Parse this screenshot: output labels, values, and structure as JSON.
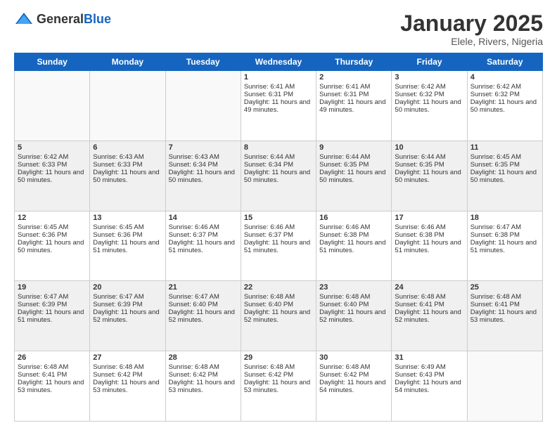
{
  "header": {
    "logo_general": "General",
    "logo_blue": "Blue",
    "month_title": "January 2025",
    "subtitle": "Elele, Rivers, Nigeria"
  },
  "days_of_week": [
    "Sunday",
    "Monday",
    "Tuesday",
    "Wednesday",
    "Thursday",
    "Friday",
    "Saturday"
  ],
  "weeks": [
    [
      {
        "day": "",
        "sunrise": "",
        "sunset": "",
        "daylight": "",
        "empty": true
      },
      {
        "day": "",
        "sunrise": "",
        "sunset": "",
        "daylight": "",
        "empty": true
      },
      {
        "day": "",
        "sunrise": "",
        "sunset": "",
        "daylight": "",
        "empty": true
      },
      {
        "day": "1",
        "sunrise": "Sunrise: 6:41 AM",
        "sunset": "Sunset: 6:31 PM",
        "daylight": "Daylight: 11 hours and 49 minutes."
      },
      {
        "day": "2",
        "sunrise": "Sunrise: 6:41 AM",
        "sunset": "Sunset: 6:31 PM",
        "daylight": "Daylight: 11 hours and 49 minutes."
      },
      {
        "day": "3",
        "sunrise": "Sunrise: 6:42 AM",
        "sunset": "Sunset: 6:32 PM",
        "daylight": "Daylight: 11 hours and 50 minutes."
      },
      {
        "day": "4",
        "sunrise": "Sunrise: 6:42 AM",
        "sunset": "Sunset: 6:32 PM",
        "daylight": "Daylight: 11 hours and 50 minutes."
      }
    ],
    [
      {
        "day": "5",
        "sunrise": "Sunrise: 6:42 AM",
        "sunset": "Sunset: 6:33 PM",
        "daylight": "Daylight: 11 hours and 50 minutes."
      },
      {
        "day": "6",
        "sunrise": "Sunrise: 6:43 AM",
        "sunset": "Sunset: 6:33 PM",
        "daylight": "Daylight: 11 hours and 50 minutes."
      },
      {
        "day": "7",
        "sunrise": "Sunrise: 6:43 AM",
        "sunset": "Sunset: 6:34 PM",
        "daylight": "Daylight: 11 hours and 50 minutes."
      },
      {
        "day": "8",
        "sunrise": "Sunrise: 6:44 AM",
        "sunset": "Sunset: 6:34 PM",
        "daylight": "Daylight: 11 hours and 50 minutes."
      },
      {
        "day": "9",
        "sunrise": "Sunrise: 6:44 AM",
        "sunset": "Sunset: 6:35 PM",
        "daylight": "Daylight: 11 hours and 50 minutes."
      },
      {
        "day": "10",
        "sunrise": "Sunrise: 6:44 AM",
        "sunset": "Sunset: 6:35 PM",
        "daylight": "Daylight: 11 hours and 50 minutes."
      },
      {
        "day": "11",
        "sunrise": "Sunrise: 6:45 AM",
        "sunset": "Sunset: 6:35 PM",
        "daylight": "Daylight: 11 hours and 50 minutes."
      }
    ],
    [
      {
        "day": "12",
        "sunrise": "Sunrise: 6:45 AM",
        "sunset": "Sunset: 6:36 PM",
        "daylight": "Daylight: 11 hours and 50 minutes."
      },
      {
        "day": "13",
        "sunrise": "Sunrise: 6:45 AM",
        "sunset": "Sunset: 6:36 PM",
        "daylight": "Daylight: 11 hours and 51 minutes."
      },
      {
        "day": "14",
        "sunrise": "Sunrise: 6:46 AM",
        "sunset": "Sunset: 6:37 PM",
        "daylight": "Daylight: 11 hours and 51 minutes."
      },
      {
        "day": "15",
        "sunrise": "Sunrise: 6:46 AM",
        "sunset": "Sunset: 6:37 PM",
        "daylight": "Daylight: 11 hours and 51 minutes."
      },
      {
        "day": "16",
        "sunrise": "Sunrise: 6:46 AM",
        "sunset": "Sunset: 6:38 PM",
        "daylight": "Daylight: 11 hours and 51 minutes."
      },
      {
        "day": "17",
        "sunrise": "Sunrise: 6:46 AM",
        "sunset": "Sunset: 6:38 PM",
        "daylight": "Daylight: 11 hours and 51 minutes."
      },
      {
        "day": "18",
        "sunrise": "Sunrise: 6:47 AM",
        "sunset": "Sunset: 6:38 PM",
        "daylight": "Daylight: 11 hours and 51 minutes."
      }
    ],
    [
      {
        "day": "19",
        "sunrise": "Sunrise: 6:47 AM",
        "sunset": "Sunset: 6:39 PM",
        "daylight": "Daylight: 11 hours and 51 minutes."
      },
      {
        "day": "20",
        "sunrise": "Sunrise: 6:47 AM",
        "sunset": "Sunset: 6:39 PM",
        "daylight": "Daylight: 11 hours and 52 minutes."
      },
      {
        "day": "21",
        "sunrise": "Sunrise: 6:47 AM",
        "sunset": "Sunset: 6:40 PM",
        "daylight": "Daylight: 11 hours and 52 minutes."
      },
      {
        "day": "22",
        "sunrise": "Sunrise: 6:48 AM",
        "sunset": "Sunset: 6:40 PM",
        "daylight": "Daylight: 11 hours and 52 minutes."
      },
      {
        "day": "23",
        "sunrise": "Sunrise: 6:48 AM",
        "sunset": "Sunset: 6:40 PM",
        "daylight": "Daylight: 11 hours and 52 minutes."
      },
      {
        "day": "24",
        "sunrise": "Sunrise: 6:48 AM",
        "sunset": "Sunset: 6:41 PM",
        "daylight": "Daylight: 11 hours and 52 minutes."
      },
      {
        "day": "25",
        "sunrise": "Sunrise: 6:48 AM",
        "sunset": "Sunset: 6:41 PM",
        "daylight": "Daylight: 11 hours and 53 minutes."
      }
    ],
    [
      {
        "day": "26",
        "sunrise": "Sunrise: 6:48 AM",
        "sunset": "Sunset: 6:41 PM",
        "daylight": "Daylight: 11 hours and 53 minutes."
      },
      {
        "day": "27",
        "sunrise": "Sunrise: 6:48 AM",
        "sunset": "Sunset: 6:42 PM",
        "daylight": "Daylight: 11 hours and 53 minutes."
      },
      {
        "day": "28",
        "sunrise": "Sunrise: 6:48 AM",
        "sunset": "Sunset: 6:42 PM",
        "daylight": "Daylight: 11 hours and 53 minutes."
      },
      {
        "day": "29",
        "sunrise": "Sunrise: 6:48 AM",
        "sunset": "Sunset: 6:42 PM",
        "daylight": "Daylight: 11 hours and 53 minutes."
      },
      {
        "day": "30",
        "sunrise": "Sunrise: 6:48 AM",
        "sunset": "Sunset: 6:42 PM",
        "daylight": "Daylight: 11 hours and 54 minutes."
      },
      {
        "day": "31",
        "sunrise": "Sunrise: 6:49 AM",
        "sunset": "Sunset: 6:43 PM",
        "daylight": "Daylight: 11 hours and 54 minutes."
      },
      {
        "day": "",
        "sunrise": "",
        "sunset": "",
        "daylight": "",
        "empty": true
      }
    ]
  ]
}
